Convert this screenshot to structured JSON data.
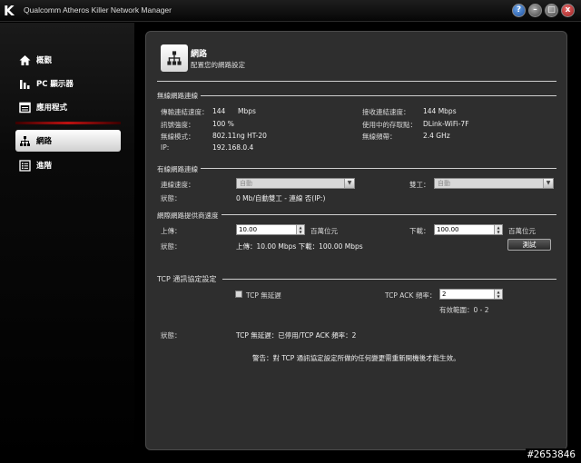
{
  "app": {
    "title": "Qualcomm Atheros Killer Network Manager",
    "logo": "K",
    "buttons": {
      "help": "?",
      "min": "–",
      "max": "□",
      "close": "x"
    }
  },
  "sidebar": {
    "items": [
      {
        "label": "概觀",
        "icon": "home-icon"
      },
      {
        "label": "PC 顯示器",
        "icon": "bar-chart-icon"
      },
      {
        "label": "應用程式",
        "icon": "application-icon"
      },
      {
        "label": "網路",
        "icon": "network-icon"
      },
      {
        "label": "進階",
        "icon": "advanced-list-icon"
      }
    ],
    "active": "網路"
  },
  "header": {
    "title": "網路",
    "subtitle": "配置您的網路設定"
  },
  "wireless": {
    "section_title": "無線網路連線",
    "tx_speed_label": "傳輸連結速度：",
    "tx_speed_value": "144",
    "tx_speed_unit": "Mbps",
    "rx_speed_label": "接收連結速度：",
    "rx_speed_value": "144  Mbps",
    "signal_label": "訊號強度：",
    "signal_value": "100 %",
    "ap_label": "使用中的存取點：",
    "ap_value": "DLink-WiFi-7F",
    "mode_label": "無線模式：",
    "mode_value": "802.11ng HT-20",
    "band_label": "無線頻帶：",
    "band_value": "2.4 GHz",
    "ip_label": "IP:",
    "ip_value": "192.168.0.4"
  },
  "wired": {
    "section_title": "有線網路連線",
    "speed_label": "連線速度：",
    "speed_value": "自動",
    "duplex_label": "雙工：",
    "duplex_value": "自動",
    "status_label": "狀態：",
    "status_value": "0 Mb/自動雙工 - 連線 否(IP:)"
  },
  "isp": {
    "section_title": "網際網路提供商速度",
    "upload_label": "上傳：",
    "upload_value": "10.00",
    "upload_unit": "百萬位元",
    "download_label": "下載：",
    "download_value": "100.00",
    "download_unit": "百萬位元",
    "status_label": "狀態：",
    "status_value": "上傳：10.00 Mbps 下載：100.00 Mbps",
    "test_button": "測試"
  },
  "tcp": {
    "section_title": "TCP 通訊協定設定",
    "nodelay_label": "TCP 無延遲",
    "ack_label": "TCP ACK 頻率：",
    "ack_value": "2",
    "range_text": "有效範圍：0 - 2",
    "status_label": "狀態：",
    "status_value": "TCP 無延遲：已停用/TCP ACK 頻率：2",
    "warning": "警告：對 TCP 通訊協定設定所做的任何變更需重新開機後才能生效。"
  },
  "watermark": "#2653846"
}
